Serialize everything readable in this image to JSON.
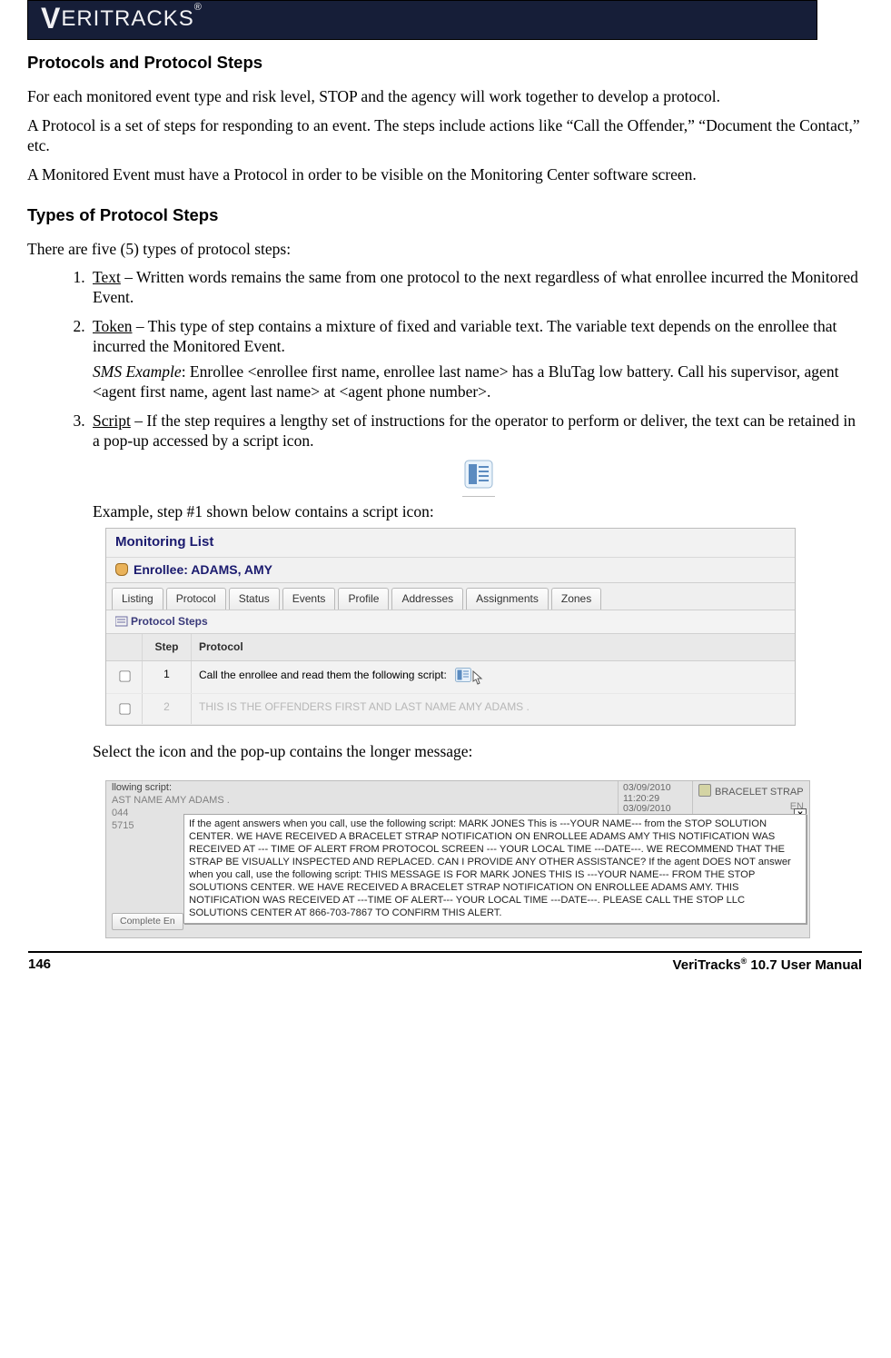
{
  "header": {
    "logo_html": "VERITRACKS",
    "reg": "®"
  },
  "section1_title": "Protocols and Protocol Steps",
  "para1": "For each monitored event type and risk level, STOP and the agency will work together to develop a protocol.",
  "para2": "A Protocol is a set of steps for responding to an event.  The steps include actions like “Call the Offender,” “Document the Contact,” etc.",
  "para3": "A Monitored Event must have a Protocol in order to be visible on the Monitoring Center software screen.",
  "section2_title": "Types of Protocol Steps",
  "para4": "There are five (5) types of protocol steps:",
  "list": {
    "i1_label": "Text",
    "i1_rest": " – Written words remains the same from one protocol to the next regardless of what enrollee incurred the Monitored Event.",
    "i2_label": "Token",
    "i2_rest": " – This type of step contains a mixture of fixed and variable text.  The variable text depends on the enrollee that incurred the Monitored Event.",
    "i2_ex_label": "SMS Example",
    "i2_ex_rest": ":  Enrollee <enrollee first name, enrollee last name> has a BluTag low battery.  Call his supervisor, agent <agent first name, agent last name> at <agent phone number>.",
    "i3_label": "Script",
    "i3_rest": " – If the step requires a lengthy set of instructions for the operator to perform or deliver, the text can be retained in a pop-up accessed by a script icon.",
    "i3_after_icon": "Example, step #1 shown below contains a script icon:",
    "i3_after_shot": "Select the icon and the pop-up contains the longer message:"
  },
  "shot1": {
    "title": "Monitoring List",
    "enrollee_label": "Enrollee: ADAMS, AMY",
    "tabs": [
      "Listing",
      "Protocol",
      "Status",
      "Events",
      "Profile",
      "Addresses",
      "Assignments",
      "Zones"
    ],
    "subhead": "Protocol Steps",
    "cols": {
      "step": "Step",
      "protocol": "Protocol"
    },
    "rows": [
      {
        "checked": false,
        "step": "1",
        "protocol": "Call the enrollee and read them the following script:"
      },
      {
        "checked": false,
        "step": "2",
        "protocol": "THIS IS THE OFFENDERS FIRST AND LAST NAME AMY ADAMS ."
      }
    ]
  },
  "shot2": {
    "left_lines": [
      "llowing script:",
      "AST NAME AMY ADAMS .",
      "044",
      "5715"
    ],
    "mid_lines": [
      "03/09/2010",
      "11:20:29",
      "03/09/2010"
    ],
    "right_badge": "BRACELET STRAP",
    "right_trail": "EN",
    "close": "x",
    "button": "Complete En",
    "popup_text": "If the agent answers when you call, use the following script: MARK JONES This is ---YOUR NAME--- from the STOP SOLUTION CENTER. WE HAVE RECEIVED A BRACELET STRAP NOTIFICATION ON ENROLLEE ADAMS AMY THIS NOTIFICATION WAS RECEIVED AT --- TIME OF ALERT FROM PROTOCOL SCREEN --- YOUR LOCAL TIME ---DATE---. WE RECOMMEND THAT THE STRAP BE VISUALLY INSPECTED AND REPLACED. CAN I PROVIDE ANY OTHER ASSISTANCE? If the agent DOES NOT answer when you call, use the following script: THIS MESSAGE IS FOR MARK JONES THIS IS ---YOUR NAME--- FROM THE STOP SOLUTIONS CENTER. WE HAVE RECEIVED A BRACELET STRAP NOTIFICATION ON ENROLLEE ADAMS AMY. THIS NOTIFICATION WAS RECEIVED AT ---TIME OF ALERT--- YOUR LOCAL TIME ---DATE---. PLEASE CALL THE STOP LLC SOLUTIONS CENTER AT 866-703-7867 TO CONFIRM THIS ALERT."
  },
  "footer": {
    "page": "146",
    "title_a": "VeriTracks",
    "reg": "®",
    "title_b": " 10.7 User Manual"
  }
}
